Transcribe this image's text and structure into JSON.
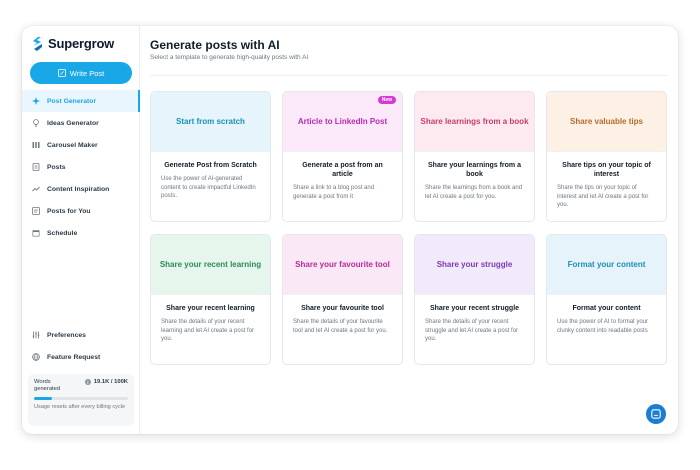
{
  "app": {
    "name": "Supergrow"
  },
  "sidebar": {
    "write_button": "Write Post",
    "items": [
      {
        "label": "Post Generator",
        "icon": "sparkle-icon",
        "active": true
      },
      {
        "label": "Ideas Generator",
        "icon": "lightbulb-icon"
      },
      {
        "label": "Carousel Maker",
        "icon": "columns-icon"
      },
      {
        "label": "Posts",
        "icon": "document-icon"
      },
      {
        "label": "Content Inspiration",
        "icon": "trend-icon"
      },
      {
        "label": "Posts for You",
        "icon": "posts-icon"
      },
      {
        "label": "Schedule",
        "icon": "calendar-icon"
      }
    ],
    "bottom_items": [
      {
        "label": "Preferences",
        "icon": "sliders-icon"
      },
      {
        "label": "Feature Request",
        "icon": "globe-icon"
      }
    ],
    "usage": {
      "label": "Words generated",
      "value": "19.1K / 100K",
      "fraction": 0.191,
      "note": "Usage resets after every billing cycle"
    }
  },
  "main": {
    "title": "Generate posts with AI",
    "subtitle": "Select a template to generate high-quality posts with AI",
    "cards": [
      {
        "top": "Start from scratch",
        "heading": "Generate Post from Scratch",
        "desc": "Use the power of AI-generated content to create impactful LinkedIn posts.",
        "accent": "#1a8fb8",
        "bg": "#e6f5fb"
      },
      {
        "top": "Article to LinkedIn Post",
        "heading": "Generate a post from an article",
        "desc": "Share a link to a blog post and generate a post from it",
        "accent": "#b62ab8",
        "bg": "#fbe8f8",
        "badge": "New"
      },
      {
        "top": "Share learnings from a book",
        "heading": "Share your learnings from a book",
        "desc": "Share the learnings from a book and let AI create a post for you.",
        "accent": "#c63b6e",
        "bg": "#fdeaf1"
      },
      {
        "top": "Share valuable tips",
        "heading": "Share tips on your topic of interest",
        "desc": "Share the tips on your topic of interest and let AI create a post for you.",
        "accent": "#b86a2c",
        "bg": "#fdf1e6"
      },
      {
        "top": "Share your recent learning",
        "heading": "Share your recent learning",
        "desc": "Share the details of your recent learning and let AI create a post for you.",
        "accent": "#2c8a5a",
        "bg": "#e6f6ec"
      },
      {
        "top": "Share your favourite tool",
        "heading": "Share your favourite tool",
        "desc": "Share the details of your favourite tool and let AI create a post for you.",
        "accent": "#b62a9a",
        "bg": "#fbe8f6"
      },
      {
        "top": "Share your struggle",
        "heading": "Share your recent struggle",
        "desc": "Share the details of your recent struggle and let AI create a post for you.",
        "accent": "#7a3ab8",
        "bg": "#f1eafb"
      },
      {
        "top": "Format your content",
        "heading": "Format your content",
        "desc": "Use the power of AI to format your clunky content into readable posts",
        "accent": "#1a8fb8",
        "bg": "#e6f3fb"
      }
    ]
  },
  "chat": {
    "icon": "chat-icon"
  },
  "colors": {
    "accent": "#1aa7e8"
  }
}
